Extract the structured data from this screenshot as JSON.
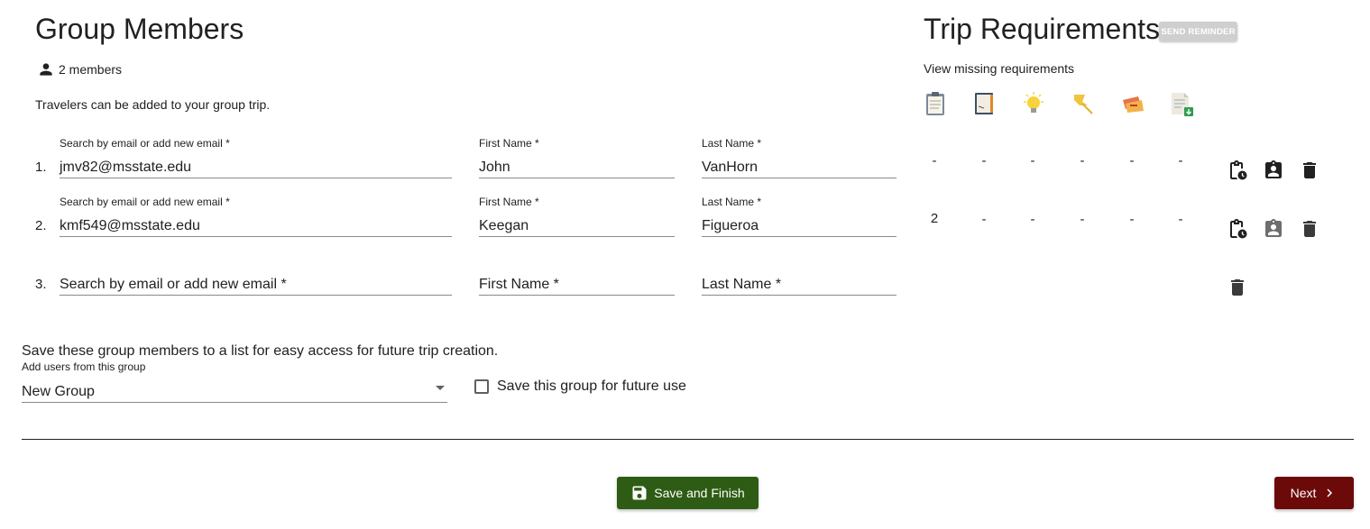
{
  "group": {
    "title": "Group Members",
    "member_count": "2 members",
    "description": "Travelers can be added to your group trip."
  },
  "members": [
    {
      "number": "1.",
      "email_label": "Search by email or add new email *",
      "email": "jmv82@msstate.edu",
      "first_label": "First Name *",
      "first": "John",
      "last_label": "Last Name *",
      "last": "VanHorn",
      "req_values": [
        "-",
        "-",
        "-",
        "-",
        "-",
        "-"
      ]
    },
    {
      "number": "2.",
      "email_label": "Search by email or add new email *",
      "email": "kmf549@msstate.edu",
      "first_label": "First Name *",
      "first": "Keegan",
      "last_label": "Last Name *",
      "last": "Figueroa",
      "req_values": [
        "2",
        "-",
        "-",
        "-",
        "-",
        "-"
      ]
    },
    {
      "number": "3.",
      "email_placeholder": "Search by email or add new email *",
      "first_placeholder": "First Name *",
      "last_placeholder": "Last Name *"
    }
  ],
  "requirements": {
    "title": "Trip Requirements",
    "send_reminder": "SEND REMINDER",
    "view_missing": "View missing requirements",
    "icons": [
      "clipboard-icon",
      "notebook-icon",
      "lightbulb-icon",
      "pushpin-icon",
      "ticket-icon",
      "document-download-icon"
    ]
  },
  "save_group": {
    "description": "Save these group members to a list for easy access for future trip creation.",
    "select_label": "Add users from this group",
    "select_value": "New Group",
    "checkbox_label": "Save this group for future use"
  },
  "buttons": {
    "save_finish": "Save and Finish",
    "next": "Next"
  },
  "colors": {
    "save_button": "#2e5c14",
    "next_button": "#6c0a0a",
    "send_reminder_disabled": "#cfcfcf"
  }
}
